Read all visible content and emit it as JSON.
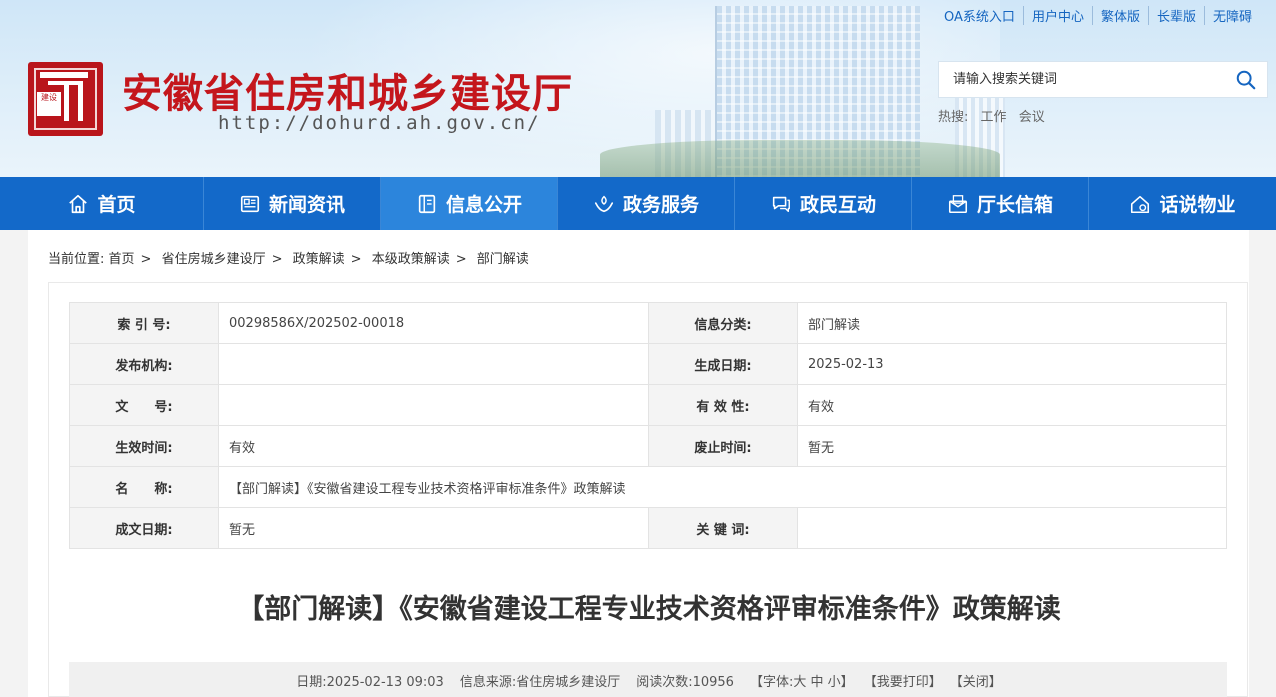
{
  "site": {
    "title": "安徽省住房和城乡建设厅",
    "url": "http://dohurd.ah.gov.cn/",
    "seal_text": "建设"
  },
  "top_links": [
    "OA系统入口",
    "用户中心",
    "繁体版",
    "长辈版",
    "无障碍"
  ],
  "search": {
    "placeholder": "请输入搜索关键词"
  },
  "hot": {
    "label": "热搜:",
    "items": [
      "工作",
      "会议"
    ]
  },
  "nav": [
    {
      "label": "首页",
      "icon": "home-icon"
    },
    {
      "label": "新闻资讯",
      "icon": "news-icon"
    },
    {
      "label": "信息公开",
      "icon": "book-icon",
      "active": true
    },
    {
      "label": "政务服务",
      "icon": "service-icon"
    },
    {
      "label": "政民互动",
      "icon": "chat-icon"
    },
    {
      "label": "厅长信箱",
      "icon": "mail-icon"
    },
    {
      "label": "话说物业",
      "icon": "property-icon"
    }
  ],
  "breadcrumb": {
    "prefix": "当前位置:",
    "items": [
      "首页",
      "省住房城乡建设厅",
      "政策解读",
      "本级政策解读",
      "部门解读"
    ]
  },
  "meta": {
    "index_label": "索 引 号:",
    "index_value": "00298586X/202502-00018",
    "category_label": "信息分类:",
    "category_value": "部门解读",
    "publisher_label": "发布机构:",
    "publisher_value": "",
    "gen_date_label": "生成日期:",
    "gen_date_value": "2025-02-13",
    "doc_no_label": "文　　号:",
    "doc_no_value": "",
    "validity_label": "有 效 性:",
    "validity_value": "有效",
    "effective_label": "生效时间:",
    "effective_value": "有效",
    "abolish_label": "废止时间:",
    "abolish_value": "暂无",
    "name_label": "名　　称:",
    "name_value": "【部门解读】《安徽省建设工程专业技术资格评审标准条件》政策解读",
    "written_label": "成文日期:",
    "written_value": "暂无",
    "keyword_label": "关 键 词:",
    "keyword_value": ""
  },
  "article": {
    "title": "【部门解读】《安徽省建设工程专业技术资格评审标准条件》政策解读",
    "date": "日期:2025-02-13 09:03",
    "source": "信息来源:省住房城乡建设厅",
    "views": "阅读次数:10956",
    "font_label": "【字体:",
    "font_large": "大",
    "font_medium": "中",
    "font_small": "小",
    "font_close": "】",
    "print": "【我要打印】",
    "close": "【关闭】"
  }
}
